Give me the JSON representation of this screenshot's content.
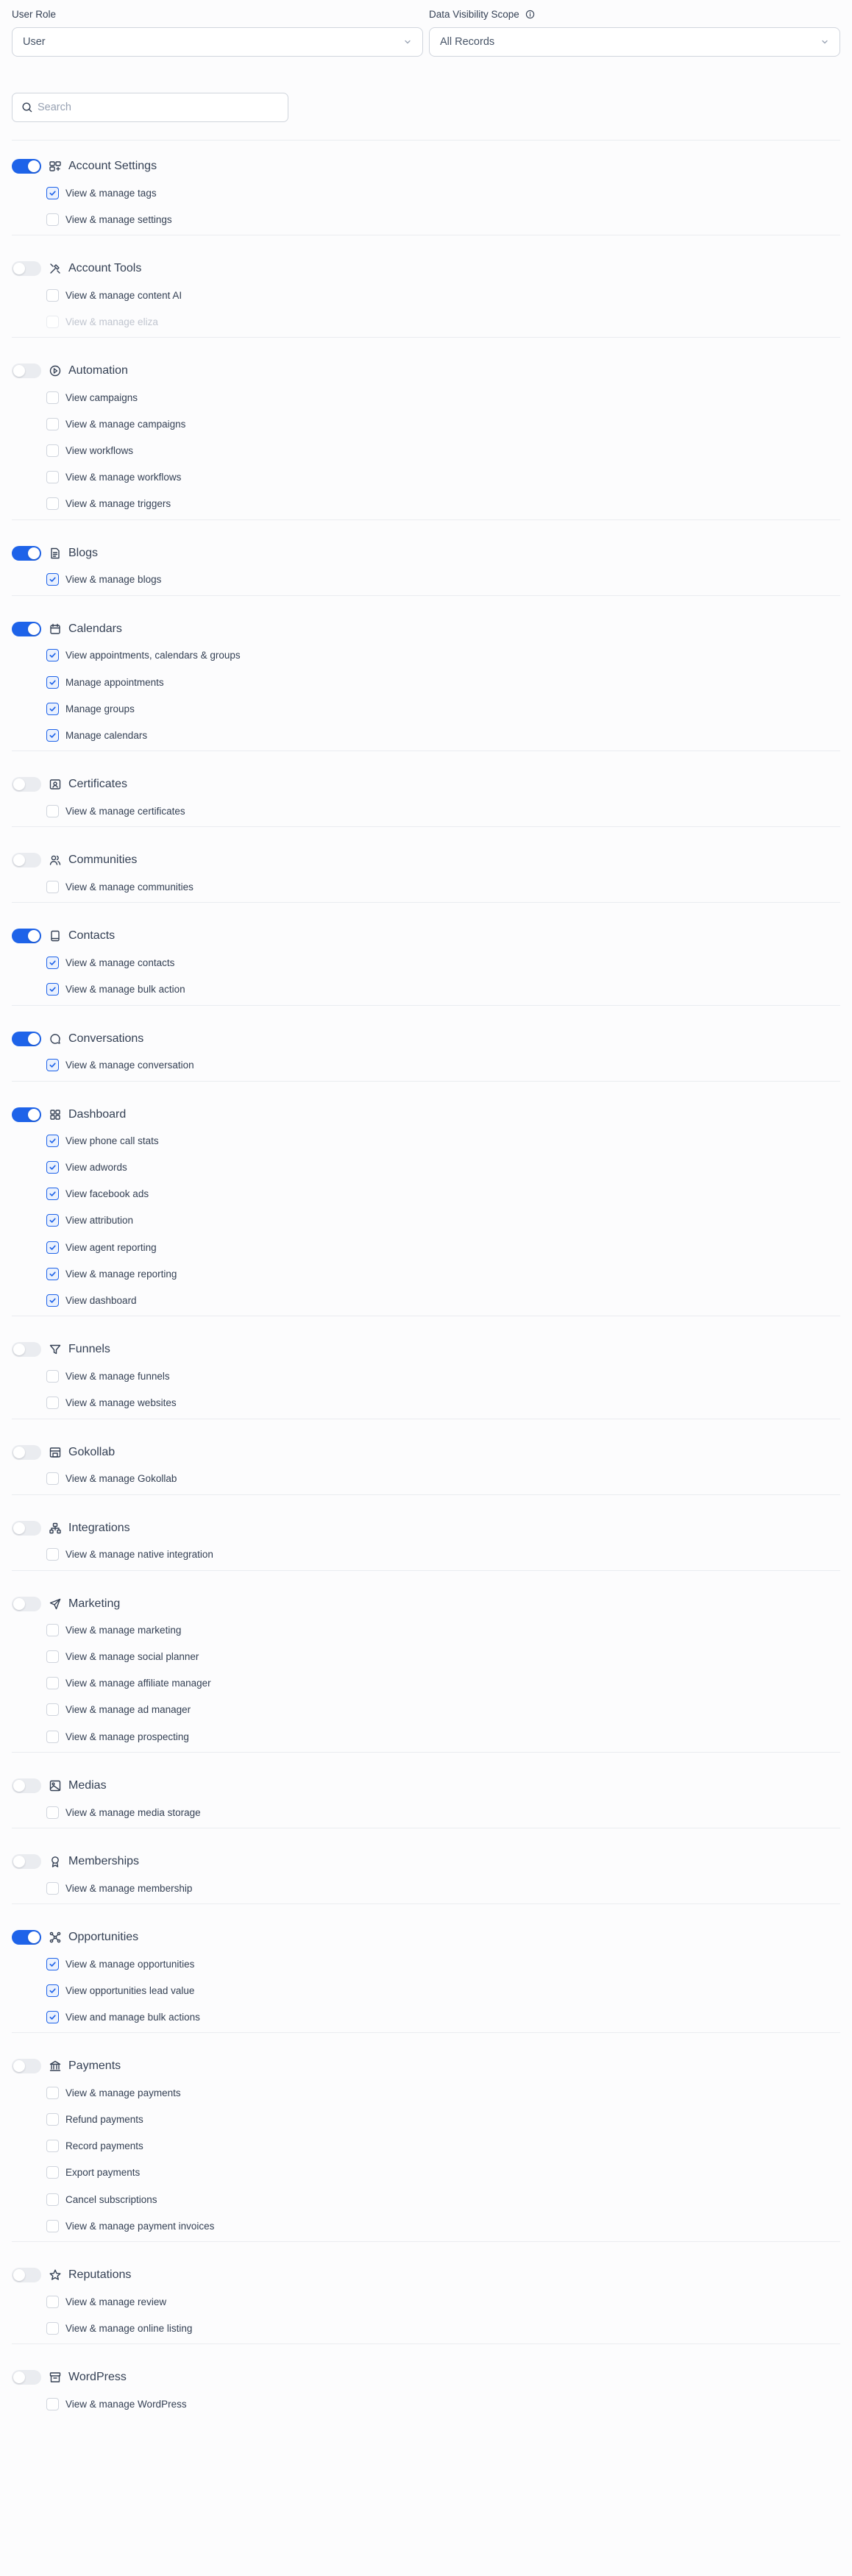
{
  "header": {
    "user_role_label": "User Role",
    "user_role_value": "User",
    "scope_label": "Data Visibility Scope",
    "scope_value": "All Records"
  },
  "search": {
    "placeholder": "Search",
    "value": ""
  },
  "sections": [
    {
      "title": "Account Settings",
      "icon": "user-settings-icon",
      "enabled": true,
      "items": [
        {
          "label": "View & manage tags",
          "checked": true
        },
        {
          "label": "View & manage settings",
          "checked": false
        }
      ]
    },
    {
      "title": "Account Tools",
      "icon": "tools-icon",
      "enabled": false,
      "items": [
        {
          "label": "View & manage content AI",
          "checked": false
        },
        {
          "label": "View & manage eliza",
          "checked": false,
          "disabled": true
        }
      ]
    },
    {
      "title": "Automation",
      "icon": "automation-icon",
      "enabled": false,
      "items": [
        {
          "label": "View campaigns",
          "checked": false
        },
        {
          "label": "View & manage campaigns",
          "checked": false
        },
        {
          "label": "View workflows",
          "checked": false
        },
        {
          "label": "View & manage workflows",
          "checked": false
        },
        {
          "label": "View & manage triggers",
          "checked": false
        }
      ]
    },
    {
      "title": "Blogs",
      "icon": "document-icon",
      "enabled": true,
      "items": [
        {
          "label": "View & manage blogs",
          "checked": true
        }
      ]
    },
    {
      "title": "Calendars",
      "icon": "calendar-icon",
      "enabled": true,
      "items": [
        {
          "label": "View appointments, calendars & groups",
          "checked": true
        },
        {
          "label": "Manage appointments",
          "checked": true
        },
        {
          "label": "Manage groups",
          "checked": true
        },
        {
          "label": "Manage calendars",
          "checked": true
        }
      ]
    },
    {
      "title": "Certificates",
      "icon": "certificate-icon",
      "enabled": false,
      "items": [
        {
          "label": "View & manage certificates",
          "checked": false
        }
      ]
    },
    {
      "title": "Communities",
      "icon": "users-icon",
      "enabled": false,
      "items": [
        {
          "label": "View & manage communities",
          "checked": false
        }
      ]
    },
    {
      "title": "Contacts",
      "icon": "contacts-book-icon",
      "enabled": true,
      "items": [
        {
          "label": "View & manage contacts",
          "checked": true
        },
        {
          "label": "View & manage bulk action",
          "checked": true
        }
      ]
    },
    {
      "title": "Conversations",
      "icon": "chat-bubble-icon",
      "enabled": true,
      "items": [
        {
          "label": "View & manage conversation",
          "checked": true
        }
      ]
    },
    {
      "title": "Dashboard",
      "icon": "dashboard-grid-icon",
      "enabled": true,
      "items": [
        {
          "label": "View phone call stats",
          "checked": true
        },
        {
          "label": "View adwords",
          "checked": true
        },
        {
          "label": "View facebook ads",
          "checked": true
        },
        {
          "label": "View attribution",
          "checked": true
        },
        {
          "label": "View agent reporting",
          "checked": true
        },
        {
          "label": "View & manage reporting",
          "checked": true
        },
        {
          "label": "View dashboard",
          "checked": true
        }
      ]
    },
    {
      "title": "Funnels",
      "icon": "funnel-icon",
      "enabled": false,
      "items": [
        {
          "label": "View & manage funnels",
          "checked": false
        },
        {
          "label": "View & manage websites",
          "checked": false
        }
      ]
    },
    {
      "title": "Gokollab",
      "icon": "storefront-icon",
      "enabled": false,
      "items": [
        {
          "label": "View & manage Gokollab",
          "checked": false
        }
      ]
    },
    {
      "title": "Integrations",
      "icon": "hierarchy-icon",
      "enabled": false,
      "items": [
        {
          "label": "View & manage native integration",
          "checked": false
        }
      ]
    },
    {
      "title": "Marketing",
      "icon": "send-icon",
      "enabled": false,
      "items": [
        {
          "label": "View & manage marketing",
          "checked": false
        },
        {
          "label": "View & manage social planner",
          "checked": false
        },
        {
          "label": "View & manage affiliate manager",
          "checked": false
        },
        {
          "label": "View & manage ad manager",
          "checked": false
        },
        {
          "label": "View & manage prospecting",
          "checked": false
        }
      ]
    },
    {
      "title": "Medias",
      "icon": "image-icon",
      "enabled": false,
      "items": [
        {
          "label": "View & manage media storage",
          "checked": false
        }
      ]
    },
    {
      "title": "Memberships",
      "icon": "award-icon",
      "enabled": false,
      "items": [
        {
          "label": "View & manage membership",
          "checked": false
        }
      ]
    },
    {
      "title": "Opportunities",
      "icon": "dataflow-icon",
      "enabled": true,
      "items": [
        {
          "label": "View & manage opportunities",
          "checked": true
        },
        {
          "label": "View opportunities lead value",
          "checked": true
        },
        {
          "label": "View and manage bulk actions",
          "checked": true
        }
      ]
    },
    {
      "title": "Payments",
      "icon": "bank-icon",
      "enabled": false,
      "items": [
        {
          "label": "View & manage payments",
          "checked": false
        },
        {
          "label": "Refund payments",
          "checked": false
        },
        {
          "label": "Record payments",
          "checked": false
        },
        {
          "label": "Export payments",
          "checked": false
        },
        {
          "label": "Cancel subscriptions",
          "checked": false
        },
        {
          "label": "View & manage payment invoices",
          "checked": false
        }
      ]
    },
    {
      "title": "Reputations",
      "icon": "star-icon",
      "enabled": false,
      "items": [
        {
          "label": "View & manage review",
          "checked": false
        },
        {
          "label": "View & manage online listing",
          "checked": false
        }
      ]
    },
    {
      "title": "WordPress",
      "icon": "archive-box-icon",
      "enabled": false,
      "items": [
        {
          "label": "View & manage WordPress",
          "checked": false
        }
      ]
    }
  ]
}
